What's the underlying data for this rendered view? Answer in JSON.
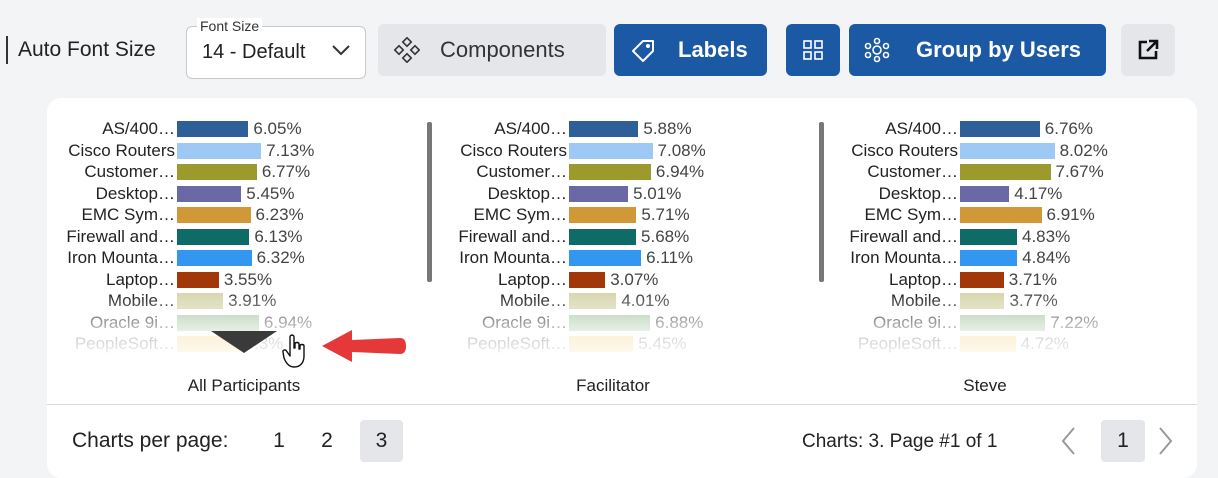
{
  "toolbar": {
    "auto_font_label": "Auto Font Size",
    "font_size": {
      "legend": "Font Size",
      "value": "14 - Default"
    },
    "components_label": "Components",
    "labels_label": "Labels",
    "group_label": "Group by Users",
    "accent_color": "#1b59a4"
  },
  "charts": [
    {
      "title": "All Participants",
      "chart_data": {
        "type": "bar",
        "orientation": "horizontal",
        "categories": [
          "AS/400…",
          "Cisco Routers",
          "Customer…",
          "Desktop…",
          "EMC Sym…",
          "Firewall and…",
          "Iron Mounta…",
          "Laptop…",
          "Mobile…",
          "Oracle 9i…",
          "PeopleSoft…"
        ],
        "values": [
          6.05,
          7.13,
          6.77,
          5.45,
          6.23,
          6.13,
          6.32,
          3.55,
          3.91,
          6.94,
          5.3
        ],
        "labels": [
          "6.05%",
          "7.13%",
          "6.77%",
          "5.45%",
          "6.23%",
          "6.13%",
          "6.32%",
          "3.55%",
          "3.91%",
          "6.94%",
          "5.3%"
        ]
      }
    },
    {
      "title": "Facilitator",
      "chart_data": {
        "type": "bar",
        "orientation": "horizontal",
        "categories": [
          "AS/400…",
          "Cisco Routers",
          "Customer…",
          "Desktop…",
          "EMC Sym…",
          "Firewall and…",
          "Iron Mounta…",
          "Laptop…",
          "Mobile…",
          "Oracle 9i…",
          "PeopleSoft…"
        ],
        "values": [
          5.88,
          7.08,
          6.94,
          5.01,
          5.71,
          5.68,
          6.11,
          3.07,
          4.01,
          6.88,
          5.45
        ],
        "labels": [
          "5.88%",
          "7.08%",
          "6.94%",
          "5.01%",
          "5.71%",
          "5.68%",
          "6.11%",
          "3.07%",
          "4.01%",
          "6.88%",
          "5.45%"
        ]
      }
    },
    {
      "title": "Steve",
      "chart_data": {
        "type": "bar",
        "orientation": "horizontal",
        "categories": [
          "AS/400…",
          "Cisco Routers",
          "Customer…",
          "Desktop…",
          "EMC Sym…",
          "Firewall and…",
          "Iron Mounta…",
          "Laptop…",
          "Mobile…",
          "Oracle 9i…",
          "PeopleSoft…"
        ],
        "values": [
          6.76,
          8.02,
          7.67,
          4.17,
          6.91,
          4.83,
          4.84,
          3.71,
          3.77,
          7.22,
          4.72
        ],
        "labels": [
          "6.76%",
          "8.02%",
          "7.67%",
          "4.17%",
          "6.91%",
          "4.83%",
          "4.84%",
          "3.71%",
          "3.77%",
          "7.22%",
          "4.72%"
        ]
      }
    }
  ],
  "bar_colors": [
    "#2f5f98",
    "#9ec9f4",
    "#9c9a2c",
    "#6b68a6",
    "#d19837",
    "#0e6b68",
    "#3397f2",
    "#a2370a",
    "#d9d7b0",
    "#a8c8a4",
    "#f5c24e"
  ],
  "footer": {
    "charts_per_page_label": "Charts per page:",
    "page_options": [
      "1",
      "2",
      "3"
    ],
    "selected_option": "3",
    "charts_info": "Charts: 3. Page #1 of 1",
    "current_page": "1"
  }
}
